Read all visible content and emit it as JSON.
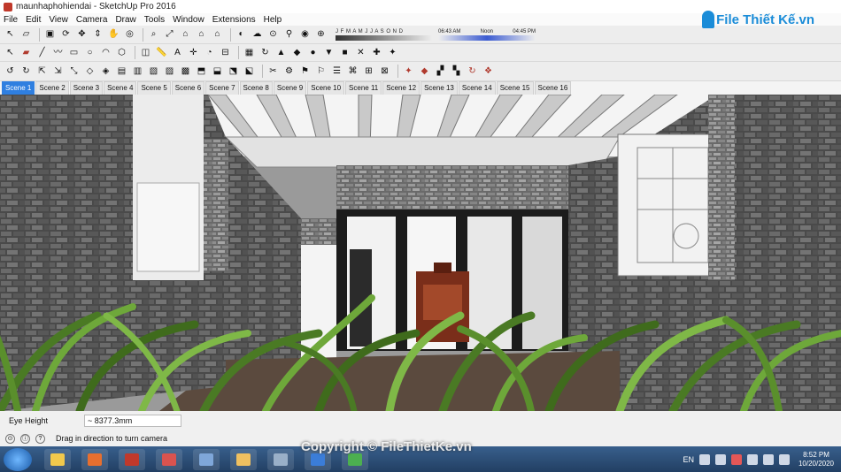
{
  "window": {
    "title": "maunhaphohiendai - SketchUp Pro 2016"
  },
  "menu": [
    "File",
    "Edit",
    "View",
    "Camera",
    "Draw",
    "Tools",
    "Window",
    "Extensions",
    "Help"
  ],
  "shadow_settings": {
    "months": "J F M A M J J A S O N D",
    "time_start": "06:43 AM",
    "time_mid": "Noon",
    "time_end": "04:45 PM"
  },
  "logo": {
    "text": "File Thiết Kế.vn"
  },
  "scenes": {
    "active_index": 0,
    "tabs": [
      "Scene 1",
      "Scene 2",
      "Scene 3",
      "Scene 4",
      "Scene 5",
      "Scene 6",
      "Scene 7",
      "Scene 8",
      "Scene 9",
      "Scene 10",
      "Scene 11",
      "Scene 12",
      "Scene 13",
      "Scene 14",
      "Scene 15",
      "Scene 16"
    ]
  },
  "measurements": {
    "label": "Eye Height",
    "value": "~ 8377.3mm"
  },
  "status": {
    "message": "Drag in direction to turn camera"
  },
  "watermark": "Copyright © FileThietKe.vn",
  "taskbar": {
    "language": "EN",
    "time": "8:52 PM",
    "date": "10/20/2020"
  },
  "icons": {
    "toolbar_1": [
      "select-icon",
      "eraser-icon",
      "cube-icon",
      "rotate-icon",
      "move-icon",
      "pushpull-icon",
      "pan-icon",
      "orbit-icon",
      "zoom-icon",
      "zoom-extents-icon",
      "house-icon",
      "house-front-icon",
      "house-left-icon",
      "shadow-icon",
      "fog-icon",
      "camera-icon",
      "walk-icon",
      "look-around-icon",
      "position-camera-icon"
    ],
    "toolbar_2": [
      "select-icon",
      "paint-icon",
      "line-icon",
      "freehand-icon",
      "rect-icon",
      "circle-icon",
      "arc-icon",
      "polygon-icon",
      "offset-icon",
      "tape-icon",
      "text-icon",
      "axes-icon",
      "protractor-icon",
      "section-icon",
      "sandbox-icon",
      "follow-me-icon"
    ],
    "toolbar_3": [
      "plugin-icon"
    ]
  },
  "colors": {
    "accent": "#2f7fe0",
    "taskbar": "#223f63",
    "brick": "#4f4f4f",
    "plant": "#4a7a24"
  }
}
